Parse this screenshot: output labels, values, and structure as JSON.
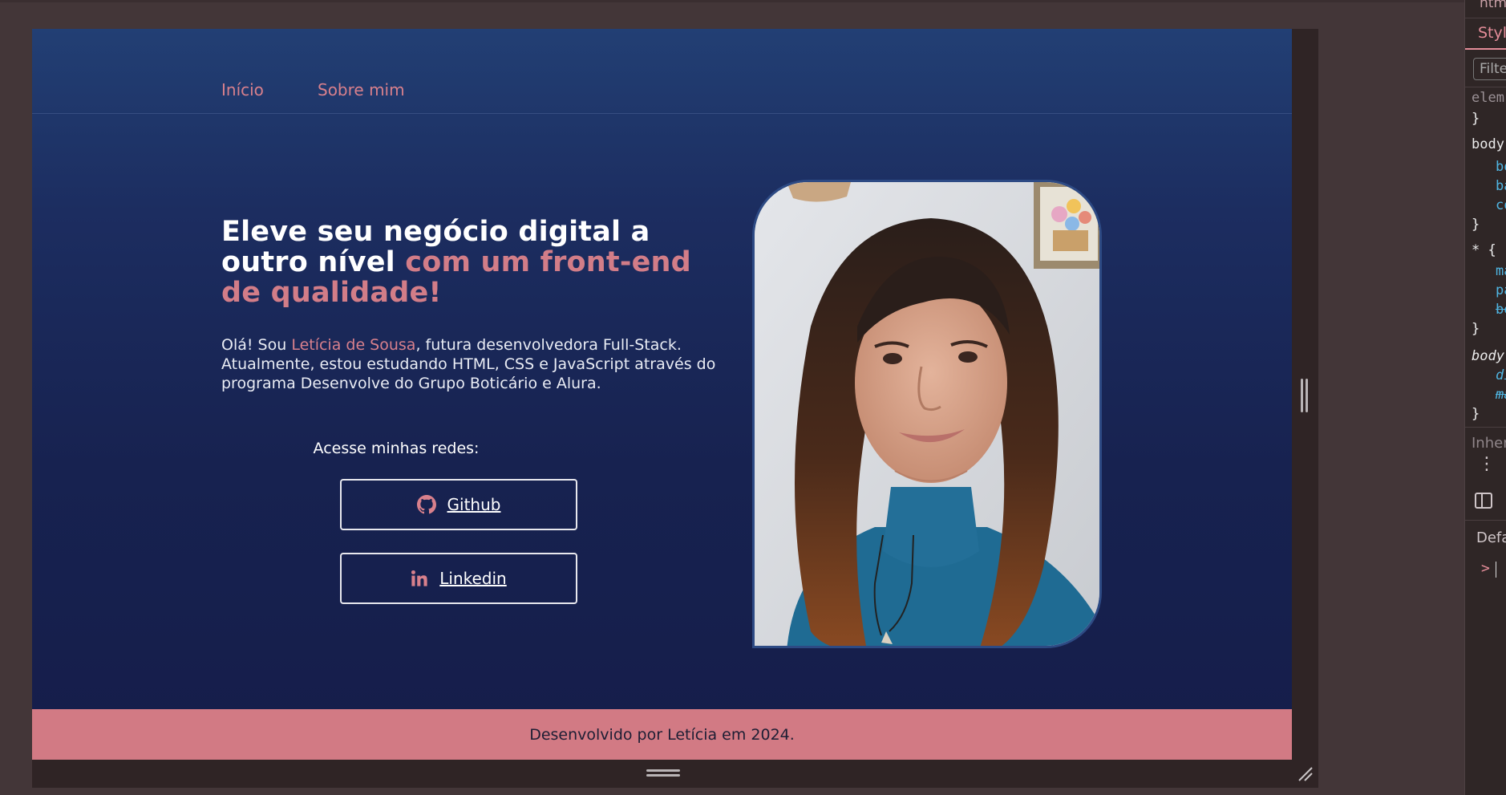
{
  "nav": {
    "home": "Início",
    "about": "Sobre mim"
  },
  "hero": {
    "title_plain": "Eleve seu negócio digital a outro nível",
    "title_accent": "com um front-end de qualidade!"
  },
  "intro": {
    "prefix": "Olá! Sou",
    "name": "Letícia de Sousa",
    "suffix": ", futura desenvolvedora Full-Stack. Atualmente, estou estudando HTML, CSS e JavaScript através do programa Desenvolve do Grupo Boticário e Alura."
  },
  "networks": {
    "label": "Acesse minhas redes:",
    "github_label": "Github",
    "github_icon": "github-icon",
    "linkedin_label": "Linkedin",
    "linkedin_icon": "linkedin-icon"
  },
  "footer": {
    "text": "Desenvolvido por Letícia em 2024."
  },
  "colors": {
    "accent": "#d27d88",
    "background_top": "#223f74",
    "background_bottom": "#151d4a",
    "footer": "#d27a84"
  },
  "devtools": {
    "tab_html": "html",
    "tab_styles": "Style",
    "filter_placeholder": "Filte",
    "lines": [
      {
        "text": "elem",
        "cls": "c-grey"
      },
      {
        "text": "}",
        "cls": "c-white"
      },
      {
        "text": "body",
        "cls": "c-white"
      },
      {
        "text": "bo",
        "cls": "c-cyan"
      },
      {
        "text": "ba",
        "cls": "c-cyan"
      },
      {
        "text": "co",
        "cls": "c-cyan"
      },
      {
        "text": "}",
        "cls": "c-white"
      },
      {
        "text": "* {",
        "cls": "c-white"
      },
      {
        "text": "ma",
        "cls": "c-cyan"
      },
      {
        "text": "pa",
        "cls": "c-cyan"
      },
      {
        "text": "bo",
        "cls": "c-cyan"
      },
      {
        "text": "}",
        "cls": "c-white"
      },
      {
        "text": "body",
        "cls": "c-white"
      },
      {
        "text": "di",
        "cls": "c-cyan"
      },
      {
        "text": "ma",
        "cls": "c-cyan"
      },
      {
        "text": "}",
        "cls": "c-white"
      }
    ],
    "inherited_label": "Inher",
    "default_label": "Defa",
    "console_prompt": ">"
  }
}
